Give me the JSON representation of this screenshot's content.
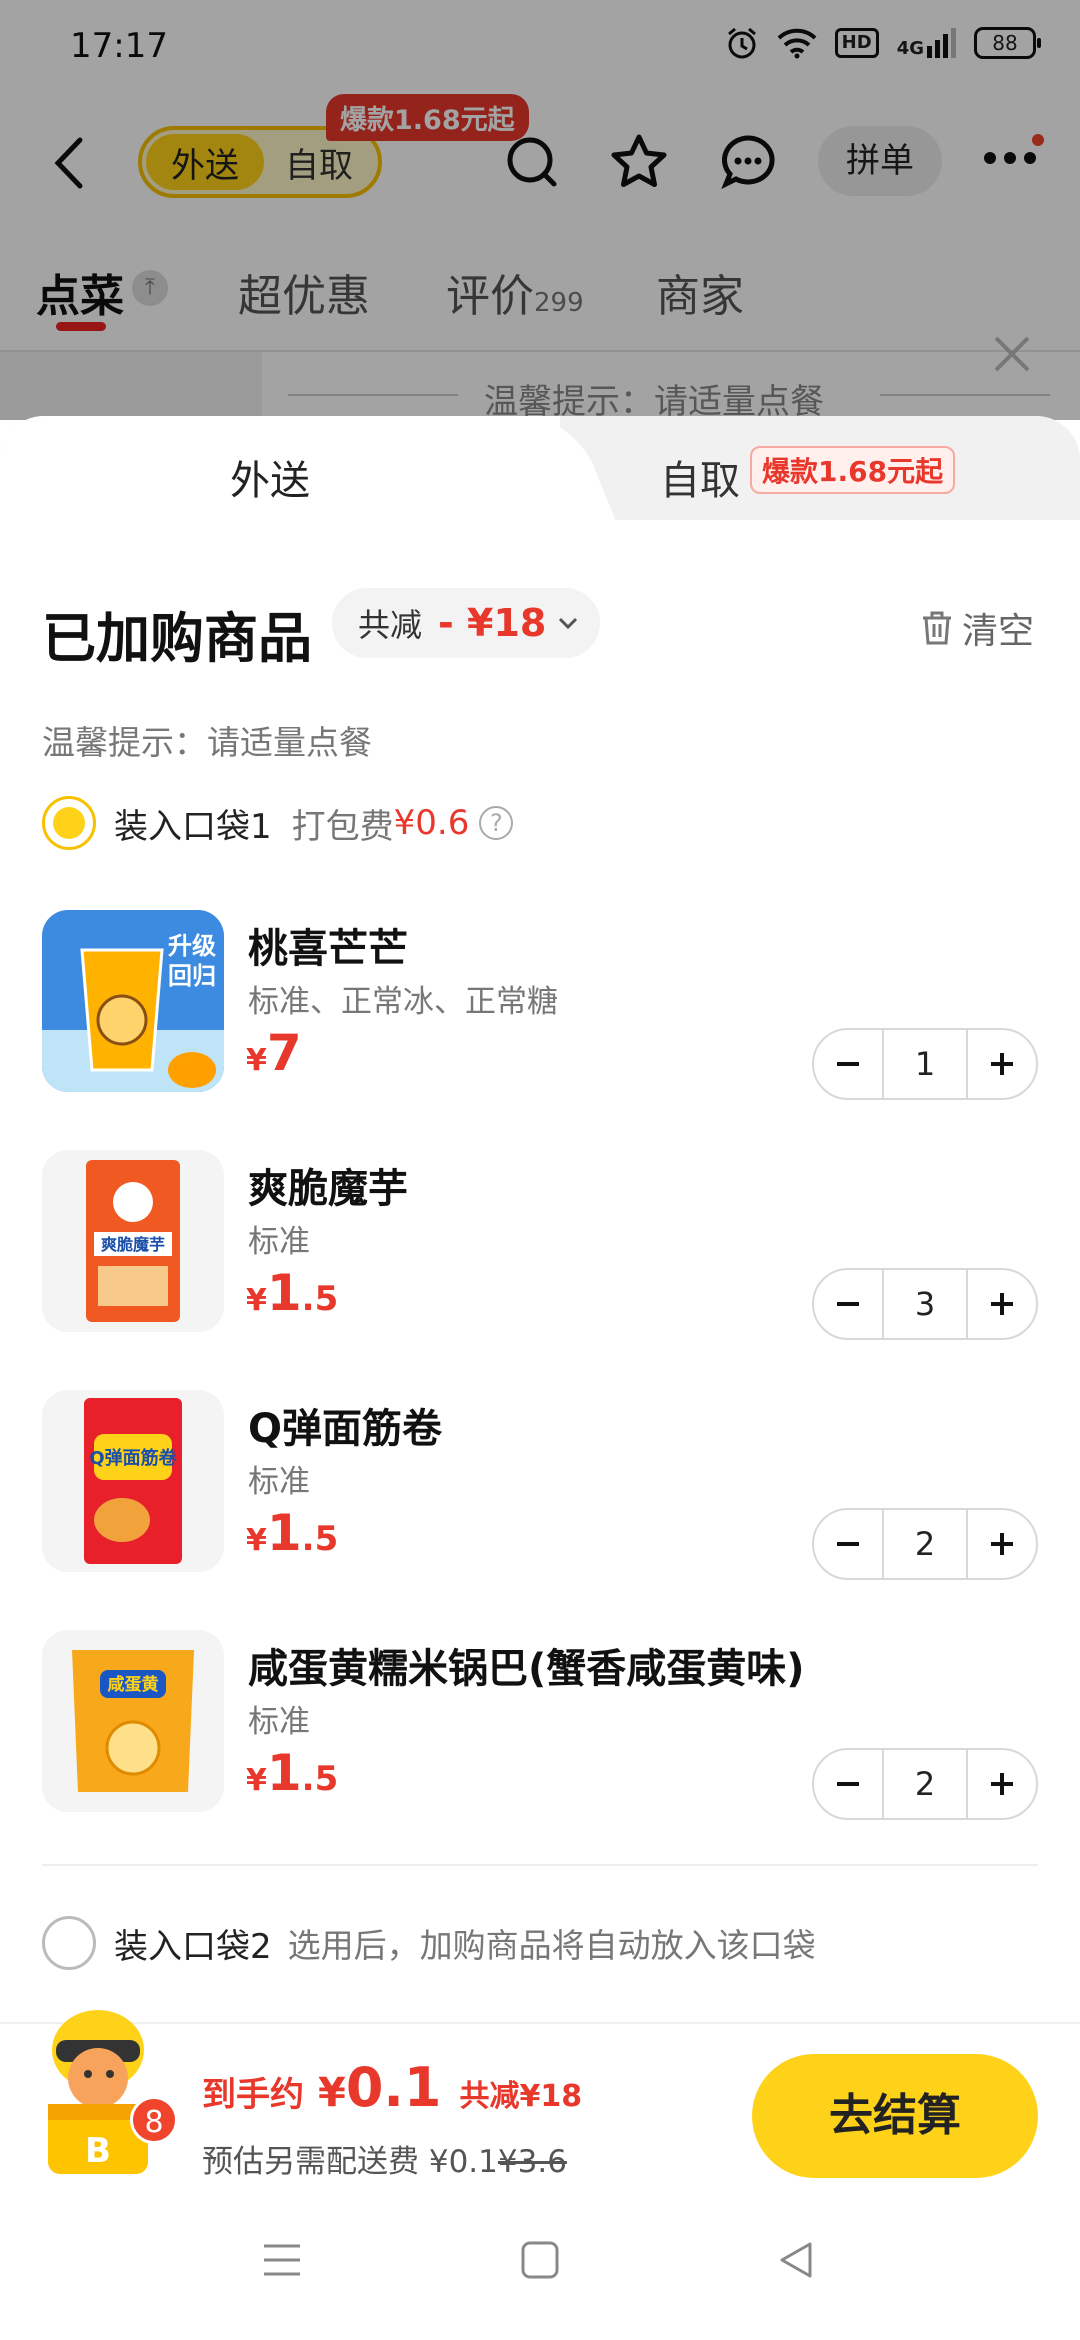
{
  "status_bar": {
    "time": "17:17",
    "hd": "HD",
    "network": "4G",
    "battery": "88"
  },
  "nav": {
    "mode_active": "外送",
    "mode_inactive": "自取",
    "promo_tag": "爆款1.68元起",
    "group_order": "拼单"
  },
  "tabs": {
    "order": "点菜",
    "deals": "超优惠",
    "reviews": "评价",
    "reviews_count": "299",
    "merchant": "商家"
  },
  "bg_tip": "温馨提示：请适量点餐",
  "sheet": {
    "tab_delivery": "外送",
    "tab_pickup": "自取",
    "tab_pickup_tag": "爆款1.68元起",
    "title": "已加购商品",
    "saving_label": "共减",
    "saving_value": "- ¥18",
    "clear": "清空",
    "tip": "温馨提示：请适量点餐",
    "bag1": {
      "name": "装入口袋1",
      "fee_label": "打包费",
      "fee_value": "¥0.6",
      "selected": true
    },
    "bag2": {
      "name": "装入口袋2",
      "note": "选用后，加购商品将自动放入该口袋",
      "selected": false
    },
    "items": [
      {
        "name": "桃喜芒芒",
        "spec": "标准、正常冰、正常糖",
        "yen": "¥",
        "price_int": "7",
        "price_dec": "",
        "qty": "1",
        "thumb": "mango-drink",
        "thumb_text": "升级回归"
      },
      {
        "name": "爽脆魔芋",
        "spec": "标准",
        "yen": "¥",
        "price_int": "1",
        "price_dec": ".5",
        "qty": "3",
        "thumb": "konjac-snack",
        "thumb_text": "爽脆魔芋"
      },
      {
        "name": "Q弹面筋卷",
        "spec": "标准",
        "yen": "¥",
        "price_int": "1",
        "price_dec": ".5",
        "qty": "2",
        "thumb": "gluten-roll-snack",
        "thumb_text": "Q弹面筋卷"
      },
      {
        "name": "咸蛋黄糯米锅巴(蟹香咸蛋黄味)",
        "spec": "标准",
        "yen": "¥",
        "price_int": "1",
        "price_dec": ".5",
        "qty": "2",
        "thumb": "rice-crust-snack",
        "thumb_text": "咸蛋黄"
      }
    ]
  },
  "bottom": {
    "badge": "8",
    "total_label": "到手约",
    "total_yen": "¥",
    "total_value": "0.1",
    "total_saving": "共减¥18",
    "fee_label": "预估另需配送费",
    "fee_new": "¥0.1",
    "fee_old": "¥3.6",
    "checkout": "去结算"
  },
  "colors": {
    "accent_red": "#e8382c",
    "brand_yellow": "#ffd21a"
  }
}
